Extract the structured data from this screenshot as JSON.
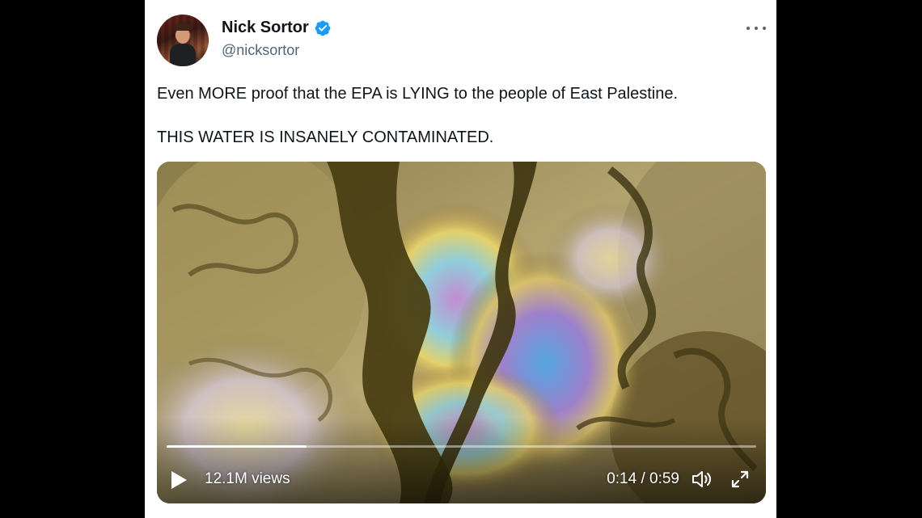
{
  "author": {
    "display_name": "Nick Sortor",
    "handle": "@nicksortor",
    "verified": true,
    "verified_color": "#1d9bf0",
    "avatar_icon": "profile-photo"
  },
  "menu": {
    "icon": "more-horizontal-icon"
  },
  "tweet": {
    "line1": "Even MORE proof that the EPA is LYING to the people of East Palestine.",
    "line2": "THIS WATER IS INSANELY CONTAMINATED."
  },
  "video": {
    "views": "12.1M views",
    "time": "0:14 / 0:59",
    "progress": 0.237,
    "play_icon": "play-icon",
    "volume_icon": "volume-icon",
    "fullscreen_icon": "fullscreen-icon"
  },
  "colors": {
    "background": "#000000",
    "card": "#ffffff",
    "text_primary": "#0f1419",
    "text_secondary": "#536471"
  }
}
